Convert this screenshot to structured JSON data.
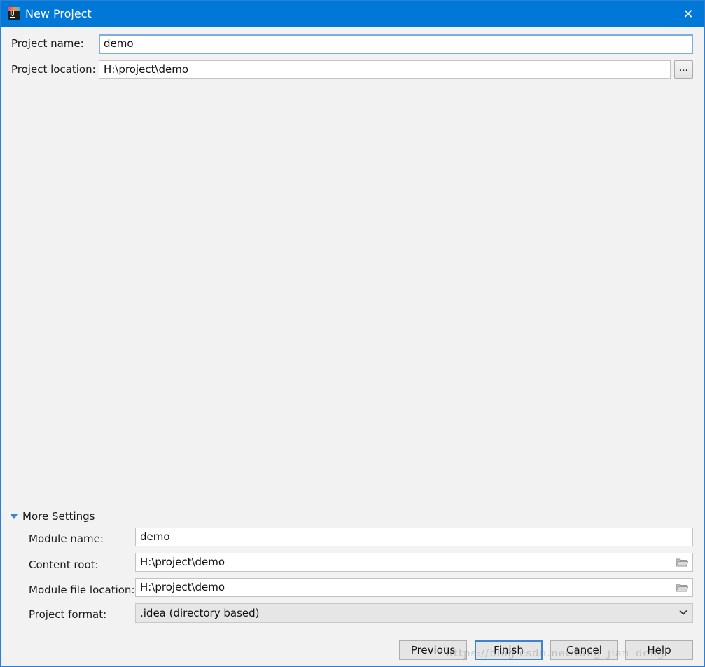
{
  "window": {
    "title": "New Project",
    "close_glyph": "✕",
    "accent_color": "#0078d7"
  },
  "project": {
    "name_label": "Project name:",
    "name_value": "demo",
    "location_label": "Project location:",
    "location_value": "H:\\project\\demo",
    "browse_label": "..."
  },
  "more_settings": {
    "label": "More Settings",
    "module_name_label": "Module name:",
    "module_name_value": "demo",
    "content_root_label": "Content root:",
    "content_root_value": "H:\\project\\demo",
    "module_file_label": "Module file location:",
    "module_file_value": "H:\\project\\demo",
    "format_label": "Project format:",
    "format_value": ".idea (directory based)"
  },
  "buttons": {
    "previous": "Previous",
    "finish": "Finish",
    "cancel": "Cancel",
    "help": "Help"
  },
  "watermark": "https://blog.csdn.net/tang_jian_dong"
}
